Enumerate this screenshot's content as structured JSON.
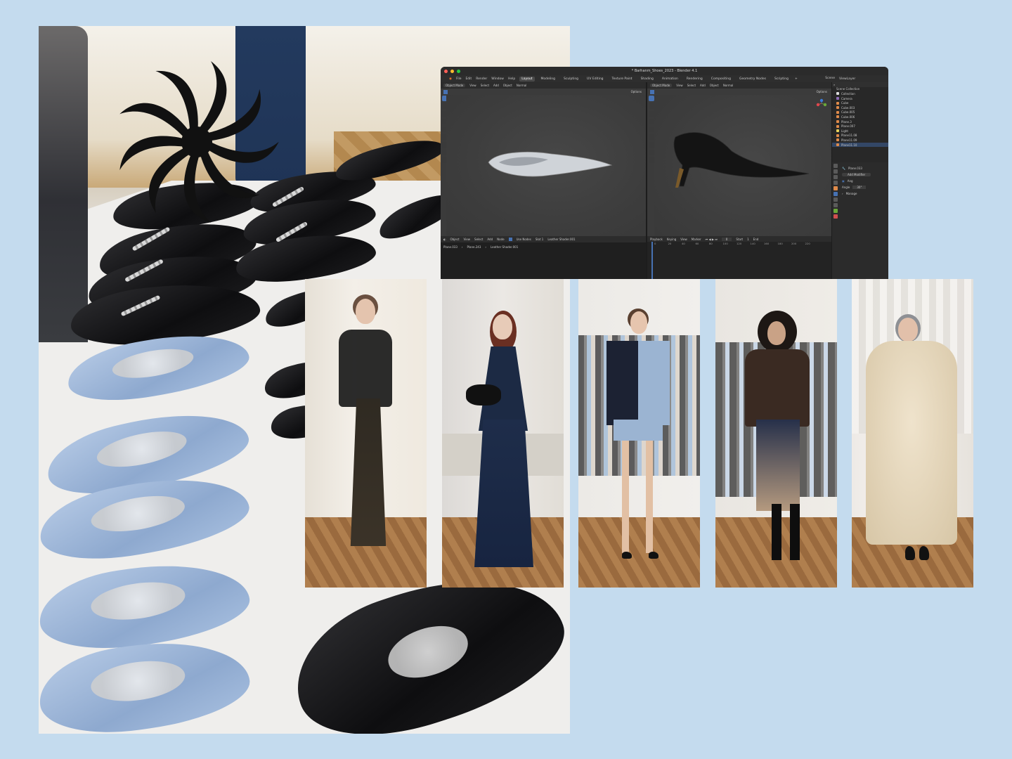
{
  "blender": {
    "title": "* Barhanm_Shoes_2023 - Blender 4.1",
    "menu": [
      "File",
      "Edit",
      "Render",
      "Window",
      "Help"
    ],
    "workspaces": [
      "Layout",
      "Modeling",
      "Sculpting",
      "UV Editing",
      "Texture Paint",
      "Shading",
      "Animation",
      "Rendering",
      "Compositing",
      "Geometry Nodes",
      "Scripting"
    ],
    "scene_label": "Scene",
    "view_layer_label": "ViewLayer",
    "viewport_left": {
      "mode": "Object Mode",
      "menus": [
        "View",
        "Select",
        "Add",
        "Object"
      ],
      "shading": "Normal",
      "options": "Options"
    },
    "viewport_right": {
      "mode": "Object Mode",
      "menus": [
        "View",
        "Select",
        "Add",
        "Object"
      ],
      "shading": "Normal",
      "options": "Options"
    },
    "outliner": {
      "title": "Scene Collection",
      "items": [
        "Collection",
        "Camera",
        "Cube",
        "Cube.003",
        "Cube.005",
        "Cube.006",
        "Plane.3",
        "Plane.007",
        "Light",
        "Plane11.08",
        "Plane11.09",
        "Plane11.10"
      ]
    },
    "properties": {
      "object_name": "Plane.033",
      "add_modifier": "Add Modifier",
      "mode_label": "Ang",
      "angle_label": "Angle",
      "angle_value": "30°",
      "manage": "Manage"
    },
    "shader_editor": {
      "object_menu": "Object",
      "menus": [
        "View",
        "Select",
        "Add",
        "Node"
      ],
      "use_nodes": "Use Nodes",
      "slot": "Slot 1",
      "material": "Leather Shader.001",
      "breadcrumb": [
        "Plane.033",
        "Plane.243",
        "Leather Shader.001"
      ]
    },
    "timeline": {
      "menus": [
        "Playback",
        "Keying",
        "View",
        "Marker"
      ],
      "start_label": "Start",
      "start_value": "1",
      "end_label": "End",
      "frame": "0",
      "ruler": [
        "0",
        "20",
        "40",
        "60",
        "80",
        "100",
        "120",
        "140",
        "160",
        "180",
        "200",
        "220",
        "240"
      ]
    },
    "colors": {
      "accent": "#4772b3",
      "bg": "#1d1d1d",
      "panel": "#2e2e2e"
    }
  },
  "photos": {
    "main": "shoe-table-photo",
    "looks": [
      "look-1-sheer-black",
      "look-2-denim-halter",
      "look-3-patchwork-blazer",
      "look-4-leather-jacket",
      "look-5-fur-coat"
    ]
  },
  "colors": {
    "background": "#c4dbee",
    "logo": "#111111"
  }
}
